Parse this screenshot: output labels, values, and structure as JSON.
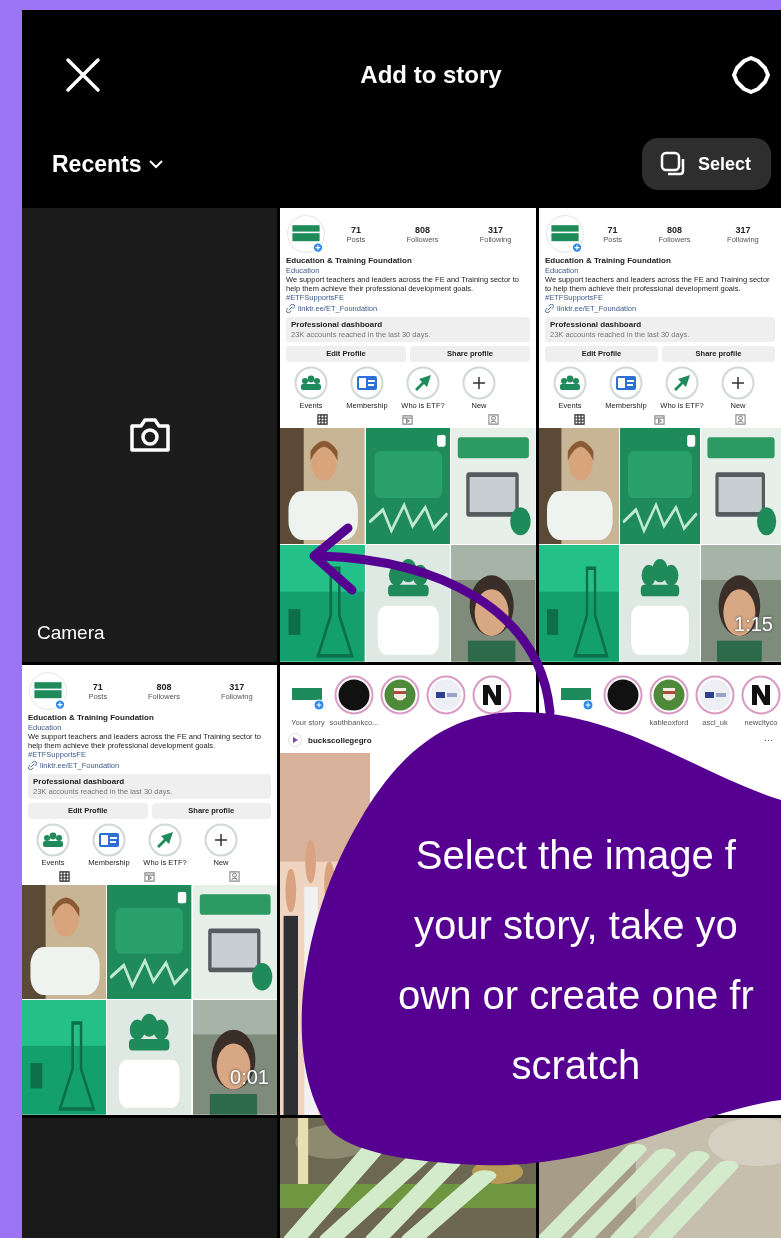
{
  "header": {
    "title": "Add to story"
  },
  "album": {
    "label": "Recents"
  },
  "select_button": {
    "label": "Select"
  },
  "grid": [
    {
      "kind": "camera",
      "label": "Camera"
    },
    {
      "kind": "profile",
      "stats": [
        {
          "value": "71",
          "label": "Posts"
        },
        {
          "value": "808",
          "label": "Followers"
        },
        {
          "value": "317",
          "label": "Following"
        }
      ],
      "name": "Education & Training Foundation",
      "category": "Education",
      "bio": "We support teachers and leaders across the FE and Training sector to help them achieve their professional development goals.",
      "hashtag": "#ETFSupportsFE",
      "link": "linktr.ee/ET_Foundation",
      "dashboard": {
        "title": "Professional dashboard",
        "subtitle": "23K accounts reached in the last 30 days."
      },
      "actions": [
        "Edit Profile",
        "Share profile"
      ],
      "highlights": [
        {
          "kind": "group",
          "label": "Events"
        },
        {
          "kind": "card",
          "label": "Membership"
        },
        {
          "kind": "arrow",
          "label": "Who is ETF?"
        },
        {
          "kind": "new",
          "label": "New"
        }
      ],
      "tabs": [
        {
          "kind": "grid",
          "selected": true
        },
        {
          "kind": "reels",
          "selected": false
        },
        {
          "kind": "tagged",
          "selected": false
        }
      ]
    },
    {
      "kind": "profile",
      "stats": [
        {
          "value": "71",
          "label": "Posts"
        },
        {
          "value": "808",
          "label": "Followers"
        },
        {
          "value": "317",
          "label": "Following"
        }
      ],
      "name": "Education & Training Foundation",
      "category": "Education",
      "bio": "We support teachers and leaders across the FE and Training sector to help them achieve their professional development goals.",
      "hashtag": "#ETFSupportsFE",
      "link": "linktr.ee/ET_Foundation",
      "dashboard": {
        "title": "Professional dashboard",
        "subtitle": "23K accounts reached in the last 30 days."
      },
      "actions": [
        "Edit Profile",
        "Share profile"
      ],
      "highlights": [
        {
          "kind": "group",
          "label": "Events"
        },
        {
          "kind": "card",
          "label": "Membership"
        },
        {
          "kind": "arrow",
          "label": "Who is ETF?"
        },
        {
          "kind": "new",
          "label": "New"
        }
      ],
      "tabs": [
        {
          "kind": "grid",
          "selected": true
        },
        {
          "kind": "reels",
          "selected": false
        },
        {
          "kind": "tagged",
          "selected": false
        }
      ],
      "duration": "1:15"
    },
    {
      "kind": "profile",
      "stats": [
        {
          "value": "71",
          "label": "Posts"
        },
        {
          "value": "808",
          "label": "Followers"
        },
        {
          "value": "317",
          "label": "Following"
        }
      ],
      "name": "Education & Training Foundation",
      "category": "Education",
      "bio": "We support teachers and leaders across the FE and Training sector to help them achieve their professional development goals.",
      "hashtag": "#ETFSupportsFE",
      "link": "linktr.ee/ET_Foundation",
      "dashboard": {
        "title": "Professional dashboard",
        "subtitle": "23K accounts reached in the last 30 days."
      },
      "actions": [
        "Edit Profile",
        "Share profile"
      ],
      "highlights": [
        {
          "kind": "group",
          "label": "Events"
        },
        {
          "kind": "card",
          "label": "Membership"
        },
        {
          "kind": "arrow",
          "label": "Who is ETF?"
        },
        {
          "kind": "new",
          "label": "New"
        }
      ],
      "tabs": [
        {
          "kind": "grid",
          "selected": true
        },
        {
          "kind": "reels",
          "selected": false
        },
        {
          "kind": "tagged",
          "selected": false
        }
      ],
      "duration": "0:01"
    },
    {
      "kind": "feed",
      "stories": [
        {
          "kind": "own",
          "label": "Your story"
        },
        {
          "kind": "dark",
          "label": "southbankco..."
        },
        {
          "kind": "crest"
        },
        {
          "kind": "logo"
        },
        {
          "kind": "letter"
        }
      ],
      "post_author": "buckscollegegro"
    },
    {
      "kind": "feed",
      "stories": [
        {
          "kind": "own"
        },
        {
          "kind": "dark"
        },
        {
          "kind": "crest",
          "label": "kableoxford"
        },
        {
          "kind": "logo",
          "label": "ascl_uk"
        },
        {
          "kind": "letter",
          "label": "newcityco"
        }
      ],
      "more": "···"
    },
    {
      "kind": "empty"
    },
    {
      "kind": "picture"
    },
    {
      "kind": "picture"
    }
  ],
  "callout": {
    "lines": [
      "Select the image f",
      "your story, take yo",
      "own or create one fr",
      "scratch"
    ]
  }
}
